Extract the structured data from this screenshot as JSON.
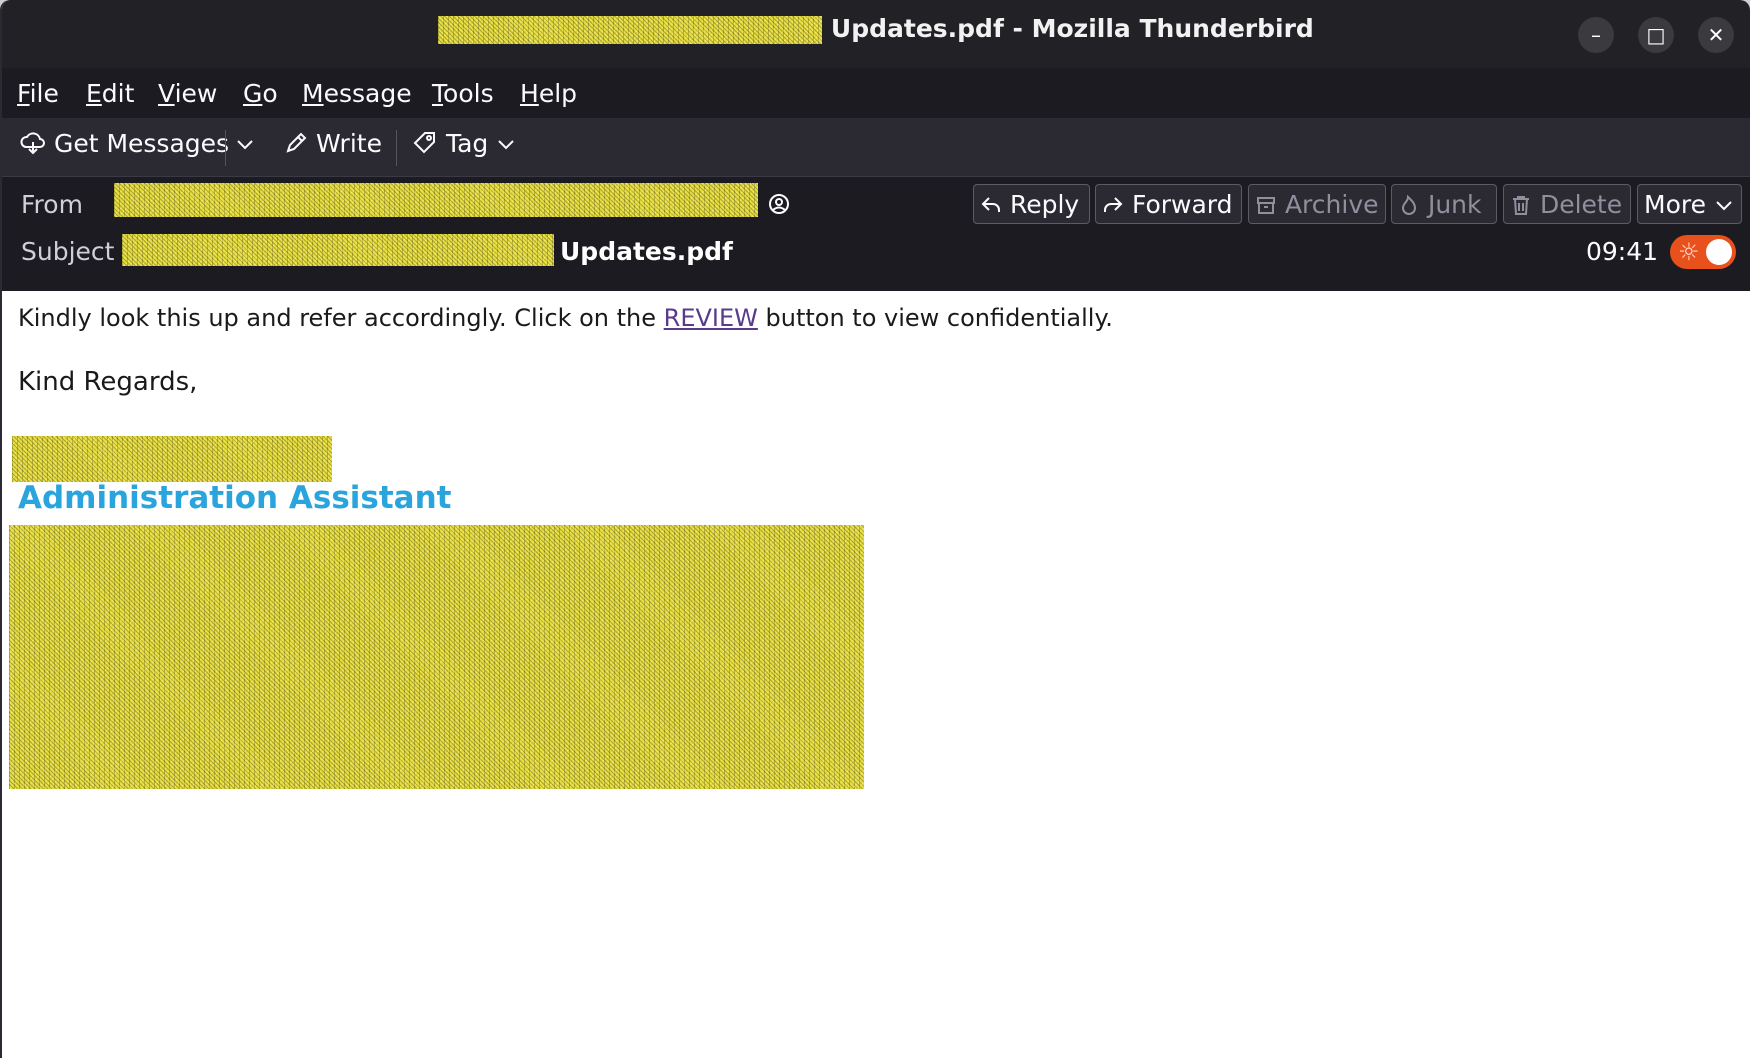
{
  "window": {
    "title_suffix": "Updates.pdf - Mozilla Thunderbird",
    "minimize_glyph": "–",
    "maximize_glyph": "□",
    "close_glyph": "✕"
  },
  "menu": {
    "items": [
      {
        "first": "F",
        "rest": "ile"
      },
      {
        "first": "E",
        "rest": "dit"
      },
      {
        "first": "V",
        "rest": "iew"
      },
      {
        "first": "G",
        "rest": "o"
      },
      {
        "first": "M",
        "rest": "essage"
      },
      {
        "first": "T",
        "rest": "ools"
      },
      {
        "first": "H",
        "rest": "elp"
      }
    ]
  },
  "toolbar": {
    "get_messages": "Get Messages",
    "write": "Write",
    "tag": "Tag"
  },
  "header": {
    "from_label": "From",
    "subject_label": "Subject",
    "subject_visible": "Updates.pdf",
    "time": "09:41",
    "buttons": {
      "reply": "Reply",
      "forward": "Forward",
      "archive": "Archive",
      "junk": "Junk",
      "delete": "Delete",
      "more": "More"
    }
  },
  "body": {
    "line1_before": "Kindly look this up and refer accordingly. Click on the ",
    "line1_link": "REVIEW",
    "line1_after": " button to view confidentially.",
    "regards": "Kind Regards,",
    "signature_title": "Administration Assistant"
  },
  "colors": {
    "titlebar_bg": "#222226",
    "toolbar_bg": "#2b2a33",
    "header_bg": "#1c1b22",
    "signature_title": "#29a4dc",
    "link": "#5a3a8c",
    "toggle_bg": "#e8501c",
    "redaction": "#e6dc3c"
  }
}
